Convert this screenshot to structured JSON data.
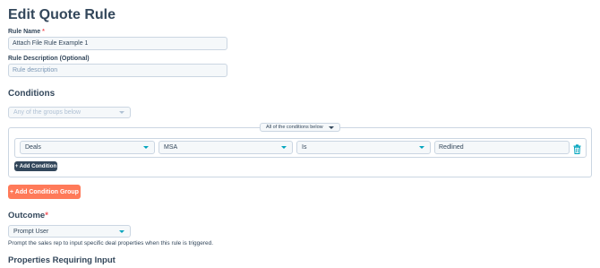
{
  "page": {
    "title": "Edit Quote Rule"
  },
  "rule_name": {
    "label": "Rule Name",
    "required_mark": "*",
    "value": "Attach File Rule Example 1"
  },
  "rule_description": {
    "label": "Rule Description (Optional)",
    "placeholder": "Rule description"
  },
  "conditions": {
    "heading": "Conditions",
    "group_match": "Any of the groups below",
    "group": {
      "match": "All of the conditions below",
      "row": {
        "object": "Deals",
        "property": "MSA",
        "operator": "Is",
        "value": "Redlined"
      },
      "add_condition_label": "+ Add Condition"
    },
    "add_group_label": "+ Add Condition Group"
  },
  "outcome": {
    "heading": "Outcome",
    "required_mark": "*",
    "selected": "Prompt User",
    "help": "Prompt the sales rep to input specific deal properties when this rule is triggered."
  },
  "properties_heading": "Properties Requiring Input",
  "colors": {
    "accent": "#00a4bd",
    "primary_button": "#ff7a59",
    "dark_button": "#33475b",
    "required": "#f2545b"
  },
  "icons": {
    "dropdown": "chevron-down-icon",
    "delete": "trash-icon"
  }
}
